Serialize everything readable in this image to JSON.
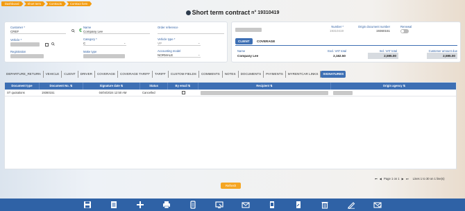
{
  "breadcrumb": [
    "Dashboard",
    "Short term",
    "Contracts",
    "Contract form"
  ],
  "title": {
    "main": "Short term contract",
    "number": "n° 19310419"
  },
  "left_form": {
    "customer_label": "Customer *",
    "customer_value": "CREF",
    "name_label": "Name",
    "name_value": "Company Lee",
    "order_ref_label": "Order reference",
    "order_ref_value": "",
    "vehicle_label": "Vehicle *",
    "category_label": "Category *",
    "category_value": "C",
    "vehicle_type_label": "Vehicle type *",
    "vehicle_type_value": "VP",
    "registration_label": "Registration",
    "make_label": "Make type",
    "accounting_label": "Accounting model",
    "accounting_value": "NORMALE"
  },
  "right_form": {
    "number_label": "Number *",
    "number_value": "19310419",
    "origin_doc_label": "Origin document number",
    "origin_doc_value": "19360151",
    "renewal_label": "Renewal",
    "tab_client": "CLIENT",
    "tab_coverage": "COVERAGE",
    "name_label": "Name",
    "name_value": "Company Lee",
    "excl_vat_label": "Excl. VAT total",
    "excl_vat_value": "2,162.50",
    "incl_vat_label": "Incl. VAT total",
    "incl_vat_value": "2,595.00",
    "amount_due_label": "Customer amount due",
    "amount_due_value": "2,595.00"
  },
  "tabs": [
    "DEPARTURE_RETURN",
    "VEHICLE",
    "CLIENT",
    "DRIVER",
    "COVERAGE",
    "COVERAGE TARIFF",
    "TARIFF",
    "CUSTOM FIELDS",
    "COMMENTS",
    "NOTES",
    "DOCUMENTS",
    "PAYMENTS",
    "MYRENTCAR LINKS",
    "SIGNATURES"
  ],
  "active_tab": "SIGNATURES",
  "grid": {
    "columns": [
      "Document type",
      "Document No. ⇅",
      "Signature date ⇅",
      "Status",
      "By email ⇅",
      "Recipient ⇅",
      "Origin agency ⇅"
    ],
    "rows": [
      {
        "doc_type": "ST quotations",
        "doc_no": "19360151",
        "sig_date": "04/04/2024 12:50 AM",
        "status": "Cancelled",
        "by_email": false
      }
    ]
  },
  "pager": {
    "page_text": "Page 1 on 1",
    "lines_text": "Lines 1 to 30 on 1 line(s)"
  },
  "refresh_label": "Refresh",
  "colors": {
    "brand_blue": "#3d6fb4",
    "accent_orange": "#f39c12",
    "toolbar": "#2f62a6"
  },
  "toolbar_icons": [
    "save-icon",
    "list-icon",
    "add-icon",
    "print-icon",
    "copy-icon",
    "monitor-icon",
    "email-icon",
    "document-icon",
    "document-edit-icon",
    "delete-icon",
    "sign-icon",
    "email-check-icon"
  ]
}
